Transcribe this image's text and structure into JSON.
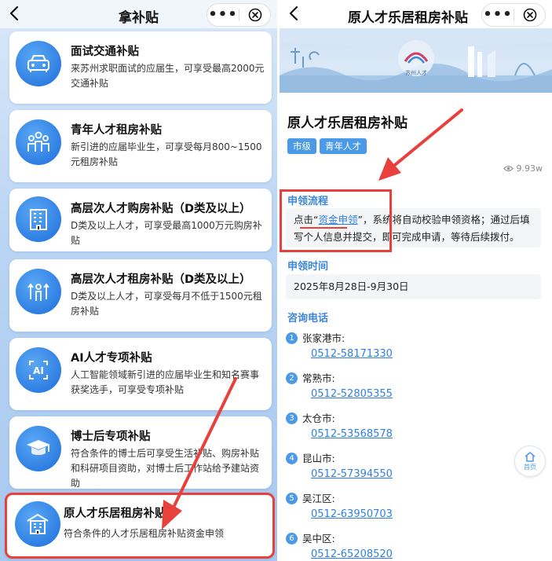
{
  "left": {
    "title": "拿补贴",
    "cards": [
      {
        "icon": "car-icon",
        "title": "面试交通补贴",
        "desc": "来苏州求职面试的应届生，可享受最高2000元交通补贴"
      },
      {
        "icon": "people-icon",
        "title": "青年人才租房补贴",
        "desc": "新引进的应届毕业生，可享受每月800~1500元租房补贴"
      },
      {
        "icon": "building-icon",
        "title": "高层次人才购房补贴（D类及以上）",
        "desc": "D类及以上人才，可享受最高1000万元购房补贴"
      },
      {
        "icon": "arrows-up-icon",
        "title": "高层次人才租房补贴（D类及以上）",
        "desc": "D类及以上人才，可享受每月不低于1500元租房补贴"
      },
      {
        "icon": "ai-icon",
        "title": "AI人才专项补贴",
        "desc": "人工智能领域新引进的应届毕业生和知名赛事获奖选手，可享受专项补贴"
      },
      {
        "icon": "graduate-cap-icon",
        "title": "博士后专项补贴",
        "desc": "符合条件的博士后可享受生活补贴、购房补贴和科研项目资助，对博士后工作站给予建站资助"
      },
      {
        "icon": "apartment-icon",
        "title": "原人才乐居租房补贴",
        "desc": "符合条件的人才乐居租房补贴资金申领"
      }
    ]
  },
  "right": {
    "title": "原人才乐居租房补贴",
    "banner_logo_text": "苏州人才",
    "page_title": "原人才乐居租房补贴",
    "tags": [
      "市级",
      "青年人才"
    ],
    "views": "9.93w",
    "flow": {
      "heading": "申领流程",
      "text_before": "点击“",
      "link": "资金申领",
      "text_after": "”，系统将自动校验申领资格；通过后填写个人信息并提交，即可完成申请，等待后续拨付。"
    },
    "time": {
      "heading": "申领时间",
      "value": "2025年8月28日-9月30日"
    },
    "contacts": {
      "heading": "咨询电话",
      "items": [
        {
          "n": "1",
          "name": "张家港市:",
          "phone": "0512-58171330"
        },
        {
          "n": "2",
          "name": "常熟市:",
          "phone": "0512-52805355"
        },
        {
          "n": "3",
          "name": "太仓市:",
          "phone": "0512-53568578"
        },
        {
          "n": "4",
          "name": "昆山市:",
          "phone": "0512-57394550"
        },
        {
          "n": "5",
          "name": "吴江区:",
          "phone": "0512-63950703"
        },
        {
          "n": "6",
          "name": "吴中区:",
          "phone": "0512-65208520"
        }
      ]
    },
    "home_label": "首页"
  },
  "colors": {
    "accent": "#2f7fe3",
    "highlight_red": "#e8403c",
    "tag_blue": "#4a9ae8"
  }
}
